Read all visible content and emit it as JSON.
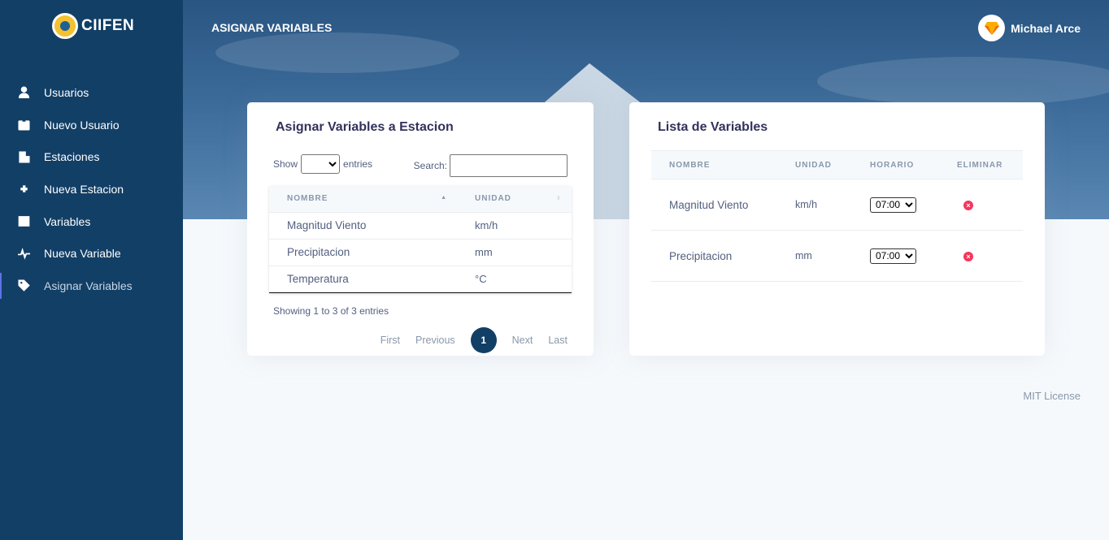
{
  "brand": {
    "name": "CIIFEN"
  },
  "sidebar": {
    "items": [
      {
        "label": "Usuarios",
        "icon": "user-icon"
      },
      {
        "label": "Nuevo Usuario",
        "icon": "id-card-icon"
      },
      {
        "label": "Estaciones",
        "icon": "building-icon"
      },
      {
        "label": "Nueva Estacion",
        "icon": "plus-icon"
      },
      {
        "label": "Variables",
        "icon": "list-box-icon"
      },
      {
        "label": "Nueva Variable",
        "icon": "pulse-icon"
      },
      {
        "label": "Asignar Variables",
        "icon": "tag-icon",
        "active": true
      }
    ]
  },
  "header": {
    "title": "ASIGNAR VARIABLES",
    "user_name": "Michael Arce"
  },
  "assign_card": {
    "title": "Asignar Variables a Estacion",
    "show_label": "Show",
    "entries_label": "entries",
    "search_label": "Search:",
    "columns": [
      "NOMBRE",
      "UNIDAD"
    ],
    "rows": [
      {
        "nombre": "Magnitud Viento",
        "unidad": "km/h"
      },
      {
        "nombre": "Precipitacion",
        "unidad": "mm"
      },
      {
        "nombre": "Temperatura",
        "unidad": "°C"
      }
    ],
    "info": "Showing 1 to 3 of 3 entries",
    "pager": {
      "first": "First",
      "previous": "Previous",
      "current": "1",
      "next": "Next",
      "last": "Last"
    }
  },
  "list_card": {
    "title": "Lista de Variables",
    "columns": [
      "NOMBRE",
      "UNIDAD",
      "HORARIO",
      "ELIMINAR"
    ],
    "rows": [
      {
        "nombre": "Magnitud Viento",
        "unidad": "km/h",
        "horario": "07:00"
      },
      {
        "nombre": "Precipitacion",
        "unidad": "mm",
        "horario": "07:00"
      }
    ]
  },
  "footer": {
    "license": "MIT License"
  },
  "colors": {
    "sidebar": "#123f66",
    "accent": "#5e72e4",
    "danger": "#f5365c"
  }
}
